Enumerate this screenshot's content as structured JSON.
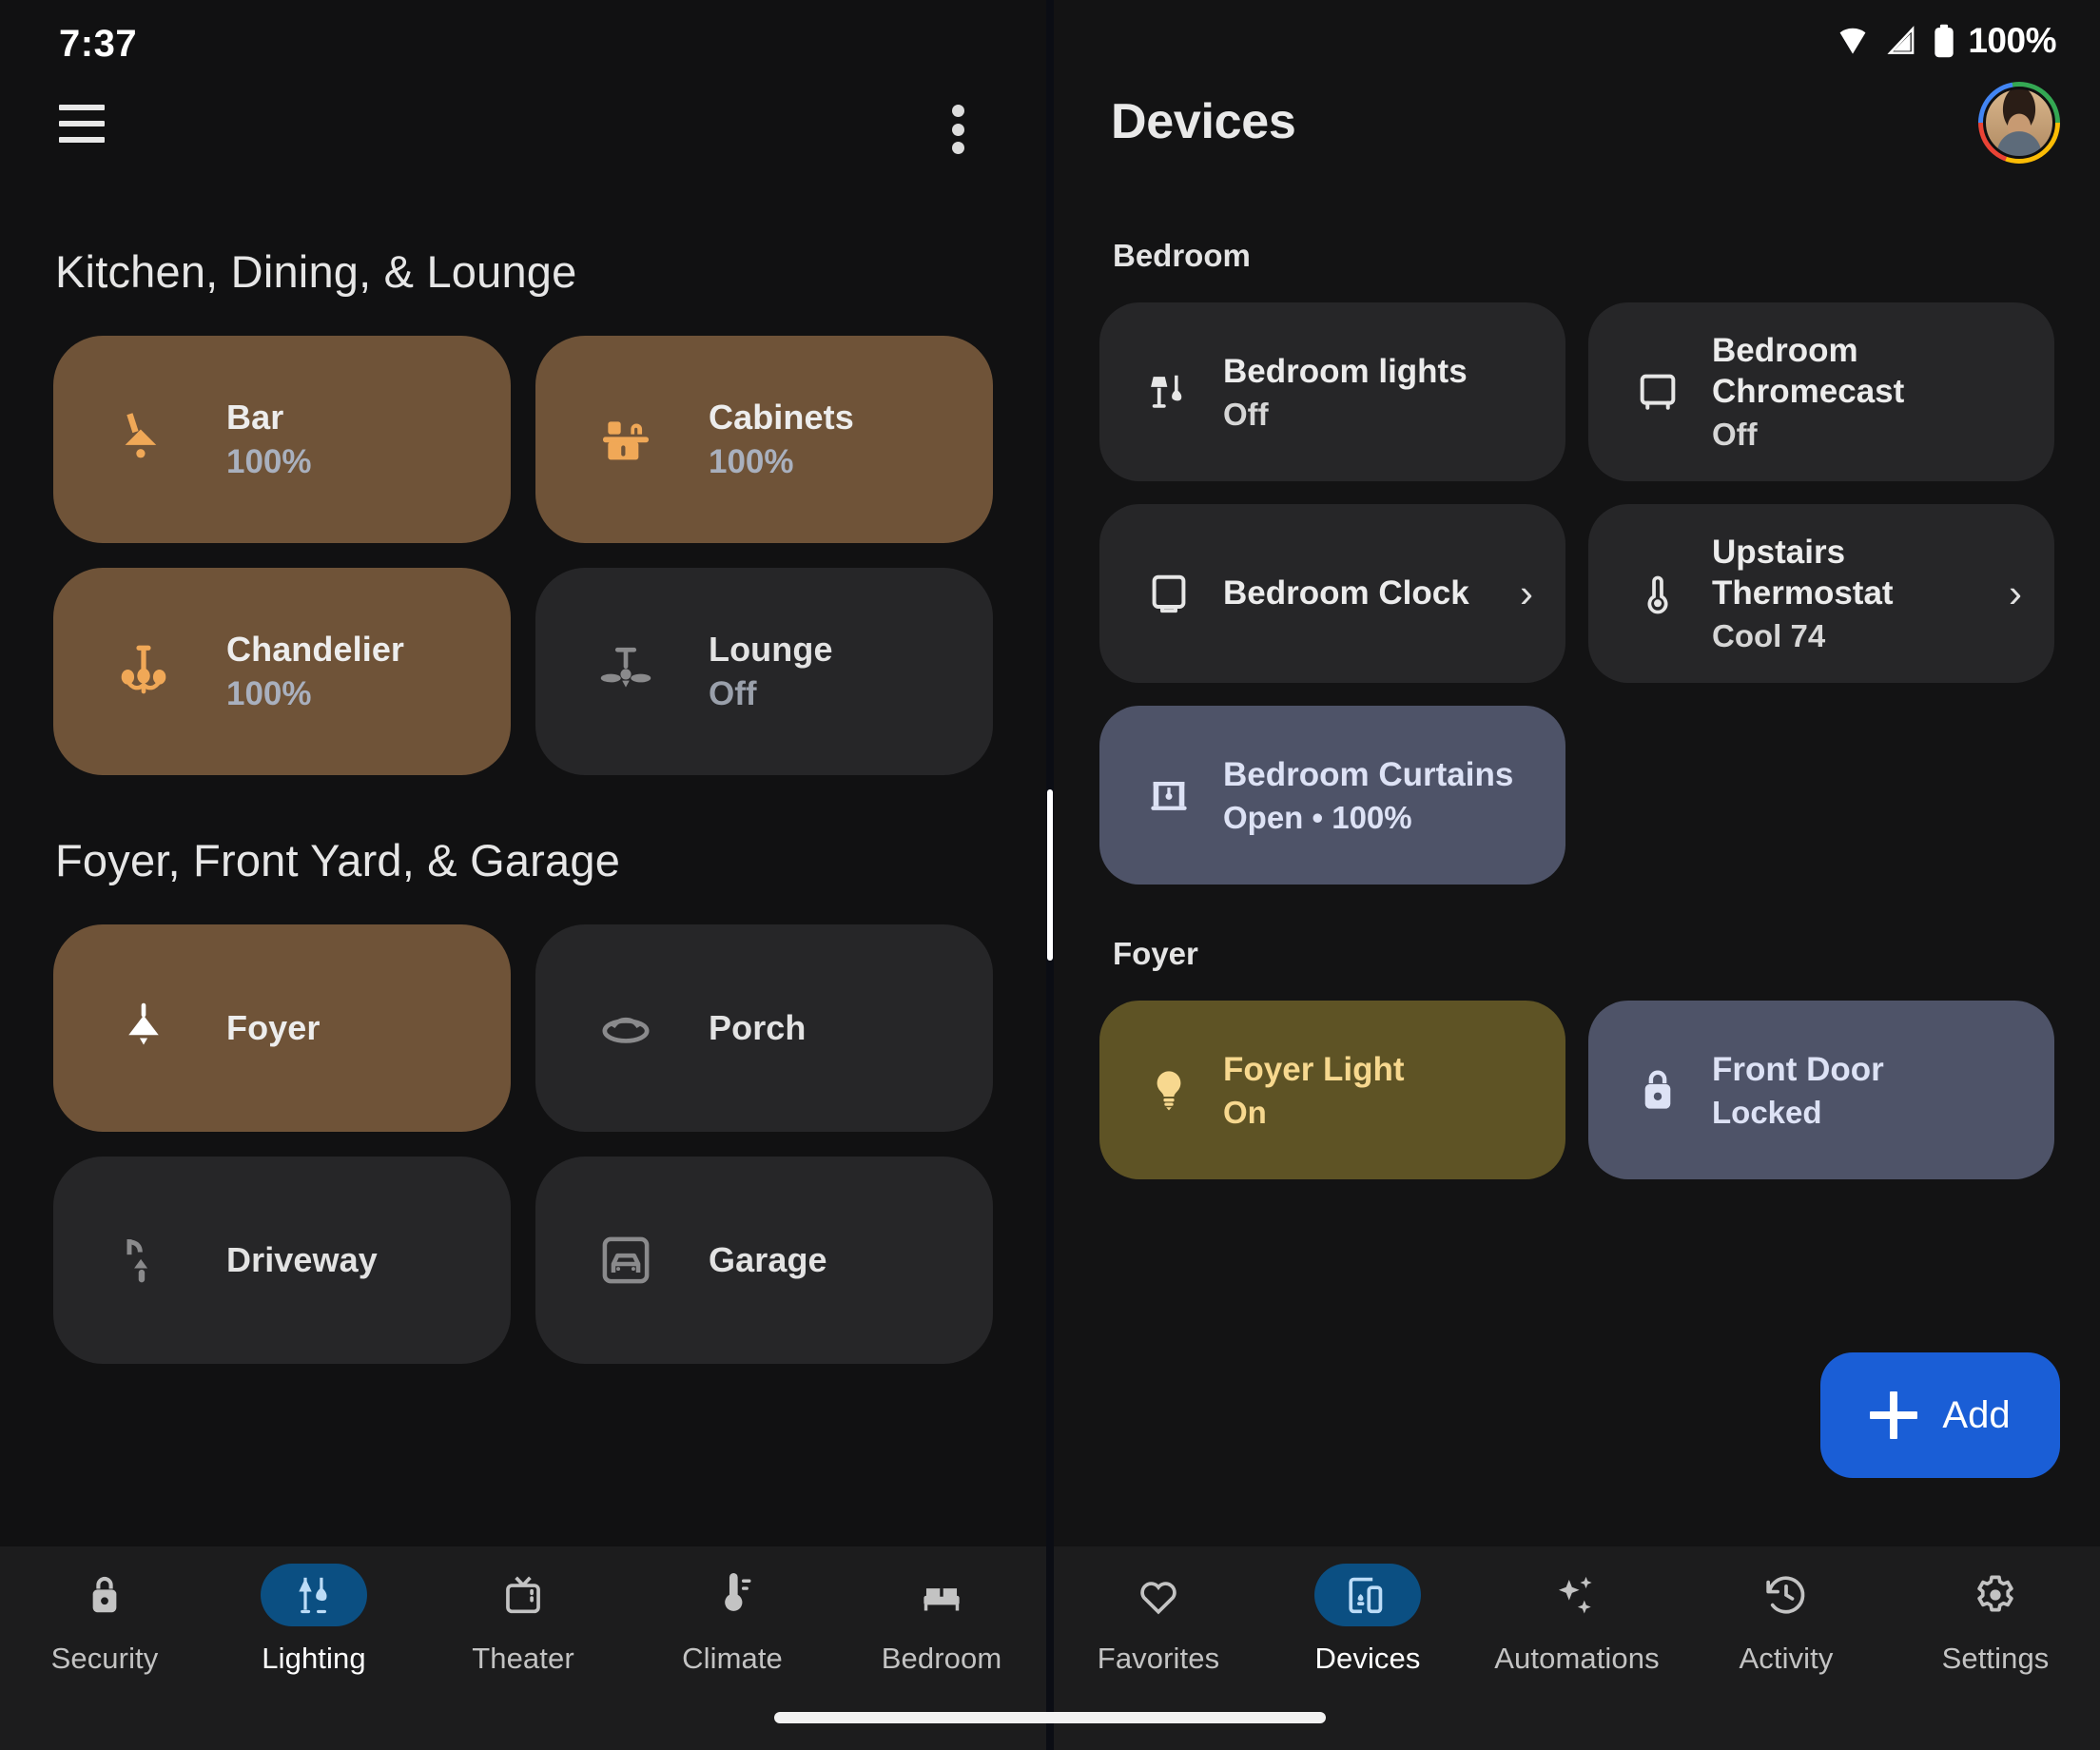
{
  "status_bar": {
    "time": "7:37",
    "battery_percent": "100%",
    "wifi_icon": "wifi-icon",
    "signal_icon": "cell-signal-icon",
    "battery_icon": "battery-full-icon"
  },
  "left_panel": {
    "menu_icon": "hamburger-menu-icon",
    "overflow_icon": "overflow-menu-icon",
    "groups": [
      {
        "title": "Kitchen, Dining, & Lounge",
        "tiles": [
          {
            "name": "Bar",
            "state": "100%",
            "icon": "wall-sconce-icon",
            "on": true
          },
          {
            "name": "Cabinets",
            "state": "100%",
            "icon": "cabinet-icon",
            "on": true
          },
          {
            "name": "Chandelier",
            "state": "100%",
            "icon": "chandelier-icon",
            "on": true
          },
          {
            "name": "Lounge",
            "state": "Off",
            "icon": "ceiling-fan-icon",
            "on": false
          }
        ]
      },
      {
        "title": "Foyer, Front Yard, & Garage",
        "tiles": [
          {
            "name": "Foyer",
            "state": "",
            "icon": "pendant-light-icon",
            "on": true
          },
          {
            "name": "Porch",
            "state": "",
            "icon": "porch-light-icon",
            "on": false
          },
          {
            "name": "Driveway",
            "state": "",
            "icon": "outdoor-lamp-icon",
            "on": false
          },
          {
            "name": "Garage",
            "state": "",
            "icon": "garage-icon",
            "on": false
          }
        ]
      }
    ],
    "bottom_nav": [
      {
        "label": "Security",
        "icon": "lock-icon",
        "active": false
      },
      {
        "label": "Lighting",
        "icon": "lamps-icon",
        "active": true
      },
      {
        "label": "Theater",
        "icon": "tv-icon",
        "active": false
      },
      {
        "label": "Climate",
        "icon": "thermometer-icon",
        "active": false
      },
      {
        "label": "Bedroom",
        "icon": "bed-icon",
        "active": false
      }
    ]
  },
  "right_panel": {
    "title": "Devices",
    "avatar_icon": "user-avatar",
    "sections": [
      {
        "room": "Bedroom",
        "devices": [
          {
            "name": "Bedroom lights",
            "state": "Off",
            "icon": "lamp-icon",
            "accent": "none",
            "chevron": false
          },
          {
            "name": "Bedroom Chromecast",
            "state": "Off",
            "icon": "chromecast-icon",
            "accent": "none",
            "chevron": false
          },
          {
            "name": "Bedroom Clock",
            "state": "",
            "icon": "clock-display-icon",
            "accent": "none",
            "chevron": true
          },
          {
            "name": "Upstairs Thermostat",
            "state": "Cool 74",
            "icon": "thermostat-icon",
            "accent": "none",
            "chevron": true
          },
          {
            "name": "Bedroom Curtains",
            "state": "Open • 100%",
            "icon": "curtains-icon",
            "accent": "blue",
            "chevron": false
          }
        ]
      },
      {
        "room": "Foyer",
        "devices": [
          {
            "name": "Foyer Light",
            "state": "On",
            "icon": "bulb-icon",
            "accent": "yellow",
            "chevron": false
          },
          {
            "name": "Front Door",
            "state": "Locked",
            "icon": "lock-icon",
            "accent": "blue",
            "chevron": false
          }
        ]
      }
    ],
    "fab": {
      "label": "Add",
      "icon": "plus-icon"
    },
    "bottom_nav": [
      {
        "label": "Favorites",
        "icon": "heart-icon",
        "active": false
      },
      {
        "label": "Devices",
        "icon": "devices-icon",
        "active": true
      },
      {
        "label": "Automations",
        "icon": "sparkle-icon",
        "active": false
      },
      {
        "label": "Activity",
        "icon": "history-icon",
        "active": false
      },
      {
        "label": "Settings",
        "icon": "gear-icon",
        "active": false
      }
    ]
  },
  "colors": {
    "tile_on": "#6f5338",
    "tile_off": "#262628",
    "accent_blue_card": "#4e5368",
    "accent_yellow_card": "#5e5325",
    "nav_active_pill": "#0b4f82",
    "fab": "#1a5ed6",
    "icon_amber": "#f0a857"
  }
}
